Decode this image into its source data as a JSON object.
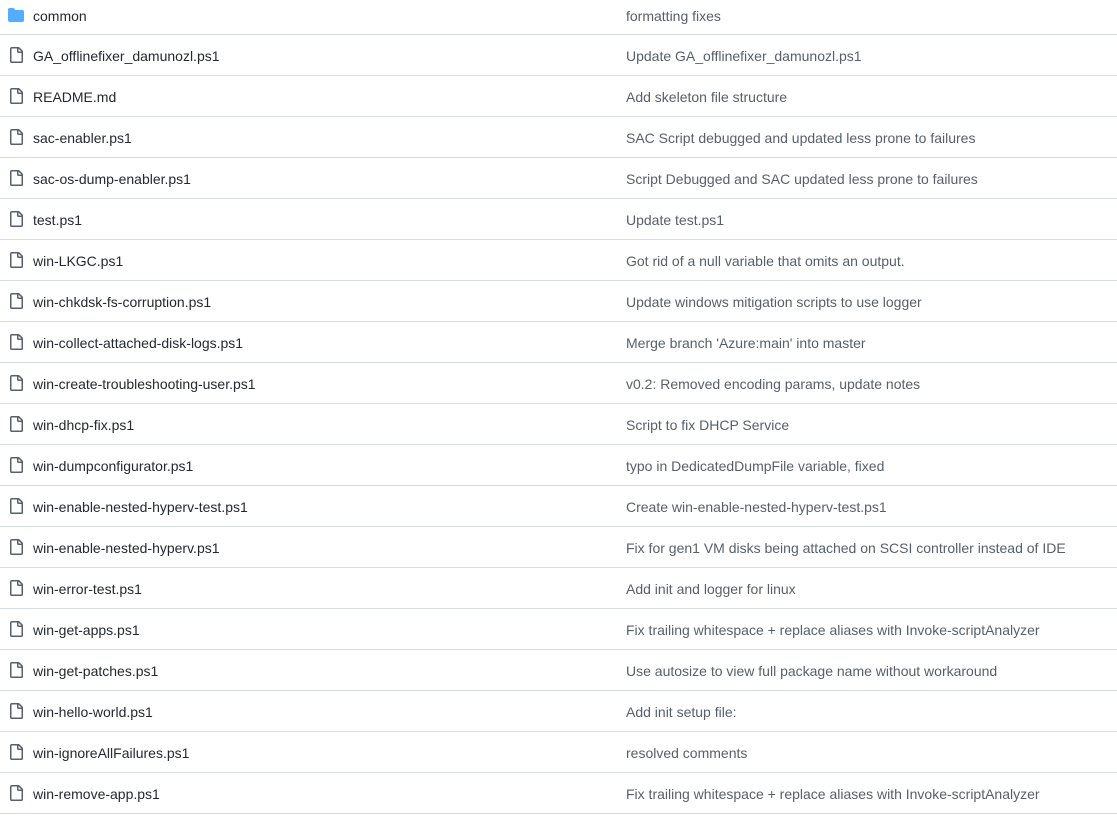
{
  "colors": {
    "folder_icon": "#54aeff",
    "file_icon": "#57606a",
    "divider": "#d8dee4",
    "name_text": "#24292f",
    "message_text": "#57606a"
  },
  "files": [
    {
      "icon": "folder-icon",
      "name": "common",
      "message": "formatting fixes"
    },
    {
      "icon": "file-icon",
      "name": "GA_offlinefixer_damunozl.ps1",
      "message": "Update GA_offlinefixer_damunozl.ps1"
    },
    {
      "icon": "file-icon",
      "name": "README.md",
      "message": "Add skeleton file structure"
    },
    {
      "icon": "file-icon",
      "name": "sac-enabler.ps1",
      "message": "SAC Script debugged and updated less prone to failures"
    },
    {
      "icon": "file-icon",
      "name": "sac-os-dump-enabler.ps1",
      "message": "Script Debugged and SAC updated less prone to failures"
    },
    {
      "icon": "file-icon",
      "name": "test.ps1",
      "message": "Update test.ps1"
    },
    {
      "icon": "file-icon",
      "name": "win-LKGC.ps1",
      "message": "Got rid of a null variable that omits an output."
    },
    {
      "icon": "file-icon",
      "name": "win-chkdsk-fs-corruption.ps1",
      "message": "Update windows mitigation scripts to use logger"
    },
    {
      "icon": "file-icon",
      "name": "win-collect-attached-disk-logs.ps1",
      "message": "Merge branch 'Azure:main' into master"
    },
    {
      "icon": "file-icon",
      "name": "win-create-troubleshooting-user.ps1",
      "message": "v0.2: Removed encoding params, update notes"
    },
    {
      "icon": "file-icon",
      "name": "win-dhcp-fix.ps1",
      "message": "Script to fix DHCP Service"
    },
    {
      "icon": "file-icon",
      "name": "win-dumpconfigurator.ps1",
      "message": "typo in DedicatedDumpFile variable, fixed"
    },
    {
      "icon": "file-icon",
      "name": "win-enable-nested-hyperv-test.ps1",
      "message": "Create win-enable-nested-hyperv-test.ps1"
    },
    {
      "icon": "file-icon",
      "name": "win-enable-nested-hyperv.ps1",
      "message": "Fix for gen1 VM disks being attached on SCSI controller instead of IDE"
    },
    {
      "icon": "file-icon",
      "name": "win-error-test.ps1",
      "message": "Add init and logger for linux"
    },
    {
      "icon": "file-icon",
      "name": "win-get-apps.ps1",
      "message": "Fix trailing whitespace + replace aliases with Invoke-scriptAnalyzer"
    },
    {
      "icon": "file-icon",
      "name": "win-get-patches.ps1",
      "message": "Use autosize to view full package name without workaround"
    },
    {
      "icon": "file-icon",
      "name": "win-hello-world.ps1",
      "message": "Add init setup file:"
    },
    {
      "icon": "file-icon",
      "name": "win-ignoreAllFailures.ps1",
      "message": "resolved comments"
    },
    {
      "icon": "file-icon",
      "name": "win-remove-app.ps1",
      "message": "Fix trailing whitespace + replace aliases with Invoke-scriptAnalyzer"
    }
  ]
}
